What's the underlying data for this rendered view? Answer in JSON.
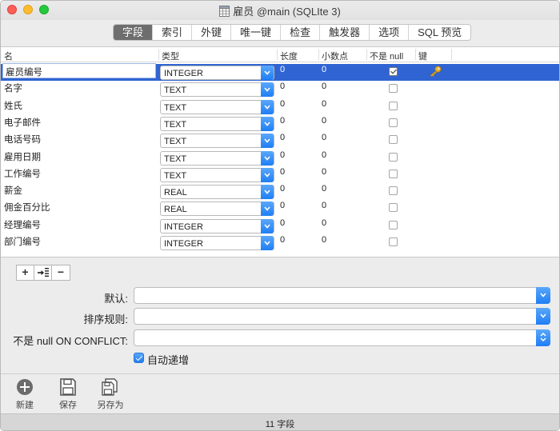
{
  "window": {
    "title": "雇员 @main (SQLIte 3)"
  },
  "tabs": [
    {
      "label": "字段",
      "active": true
    },
    {
      "label": "索引"
    },
    {
      "label": "外键"
    },
    {
      "label": "唯一键"
    },
    {
      "label": "检查"
    },
    {
      "label": "触发器"
    },
    {
      "label": "选项"
    },
    {
      "label": "SQL 预览"
    }
  ],
  "table": {
    "headers": {
      "name": "名",
      "type": "类型",
      "length": "长度",
      "decimals": "小数点",
      "not_null": "不是 null",
      "key": "键"
    },
    "rows": [
      {
        "name": "雇员编号",
        "type": "INTEGER",
        "length": "0",
        "decimals": "0",
        "not_null": true,
        "key": true,
        "selected": true
      },
      {
        "name": "名字",
        "type": "TEXT",
        "length": "0",
        "decimals": "0",
        "not_null": false,
        "key": false
      },
      {
        "name": "姓氏",
        "type": "TEXT",
        "length": "0",
        "decimals": "0",
        "not_null": false,
        "key": false
      },
      {
        "name": "电子邮件",
        "type": "TEXT",
        "length": "0",
        "decimals": "0",
        "not_null": false,
        "key": false
      },
      {
        "name": "电话号码",
        "type": "TEXT",
        "length": "0",
        "decimals": "0",
        "not_null": false,
        "key": false
      },
      {
        "name": "雇用日期",
        "type": "TEXT",
        "length": "0",
        "decimals": "0",
        "not_null": false,
        "key": false
      },
      {
        "name": "工作编号",
        "type": "TEXT",
        "length": "0",
        "decimals": "0",
        "not_null": false,
        "key": false
      },
      {
        "name": "薪金",
        "type": "REAL",
        "length": "0",
        "decimals": "0",
        "not_null": false,
        "key": false
      },
      {
        "name": "佣金百分比",
        "type": "REAL",
        "length": "0",
        "decimals": "0",
        "not_null": false,
        "key": false
      },
      {
        "name": "经理编号",
        "type": "INTEGER",
        "length": "0",
        "decimals": "0",
        "not_null": false,
        "key": false
      },
      {
        "name": "部门编号",
        "type": "INTEGER",
        "length": "0",
        "decimals": "0",
        "not_null": false,
        "key": false
      }
    ]
  },
  "row_buttons": {
    "add": "+",
    "remove": "−"
  },
  "form": {
    "default_label": "默认:",
    "collation_label": "排序规则:",
    "on_conflict_label": "不是 null ON CONFLICT:",
    "default_value": "",
    "collation_value": "",
    "on_conflict_value": "",
    "auto_increment_label": "自动递增",
    "auto_increment_checked": true
  },
  "toolbar": {
    "new_label": "新建",
    "save_label": "保存",
    "save_as_label": "另存为"
  },
  "status": {
    "text": "11 字段"
  },
  "colors": {
    "selection": "#2f64d2",
    "accent": "#1f7ef4"
  }
}
